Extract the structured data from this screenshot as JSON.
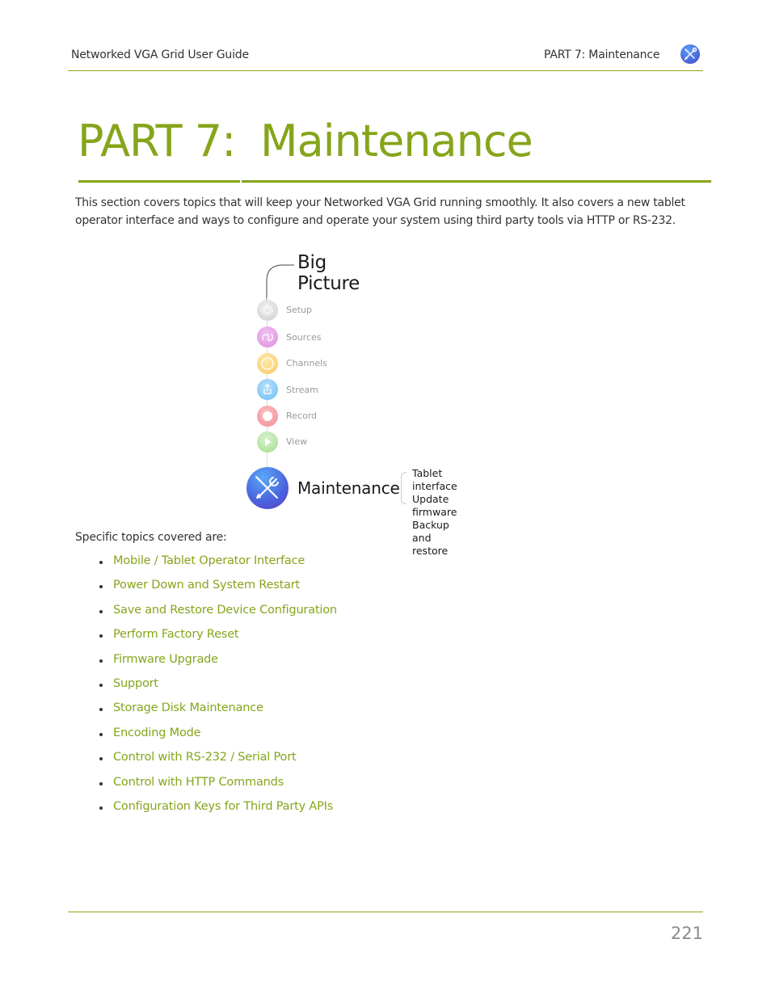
{
  "header": {
    "doc_title": "Networked VGA Grid User Guide",
    "section": "PART 7: Maintenance",
    "icon": "tools-icon"
  },
  "title": {
    "part": "PART 7:",
    "name": "Maintenance"
  },
  "intro": "This section covers topics that will keep your Networked VGA Grid running smoothly. It also covers a new tablet operator interface and ways to configure and operate your system using third party tools via HTTP or RS-232.",
  "big_picture": {
    "title": "Big Picture",
    "steps": [
      {
        "label": "Setup",
        "icon": "gear-icon",
        "color": "#d0d0d0"
      },
      {
        "label": "Sources",
        "icon": "sources-icon",
        "color": "#e6a0e6"
      },
      {
        "label": "Channels",
        "icon": "channels-icon",
        "color": "#fdd27a"
      },
      {
        "label": "Stream",
        "icon": "share-icon",
        "color": "#8fcdf7"
      },
      {
        "label": "Record",
        "icon": "record-icon",
        "color": "#f7a3ab"
      },
      {
        "label": "View",
        "icon": "play-icon",
        "color": "#b9e6a6"
      }
    ],
    "current": {
      "label": "Maintenance",
      "icon": "tools-icon",
      "sub_items": [
        "Tablet interface",
        "Update firmware",
        "Backup and restore"
      ]
    }
  },
  "topics": {
    "intro": "Specific topics covered are:",
    "items": [
      "Mobile / Tablet Operator Interface",
      "Power Down and System Restart",
      "Save and Restore Device Configuration",
      "Perform Factory Reset",
      "Firmware Upgrade",
      "Support",
      "Storage Disk Maintenance",
      "Encoding Mode",
      "Control with RS-232 / Serial Port",
      "Control with HTTP Commands",
      "Configuration Keys for Third Party APIs"
    ]
  },
  "footer": {
    "page_number": "221"
  },
  "colors": {
    "accent": "#86a51b",
    "maintenance_blue": "#4a62dc"
  }
}
